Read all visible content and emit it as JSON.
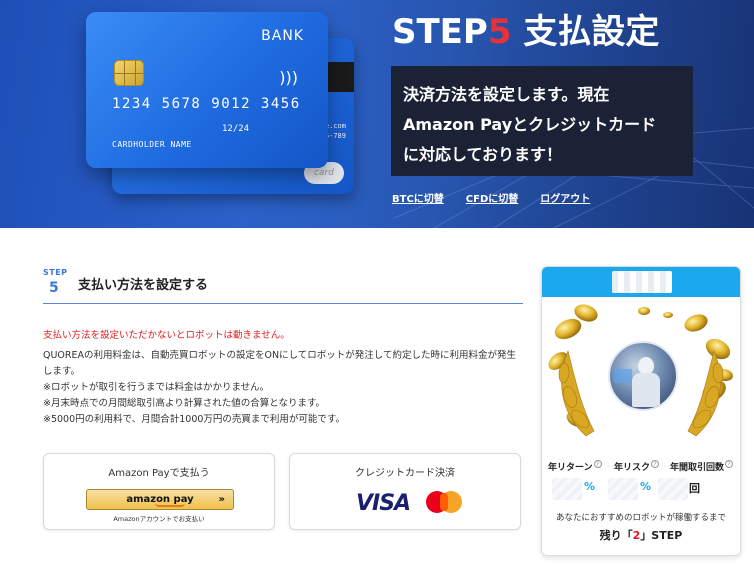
{
  "hero": {
    "card": {
      "bank": "BANK",
      "number": "1234 5678 9012 3456",
      "expiry": "12/24",
      "holder": "CARDHOLDER NAME",
      "back_text": "the.com\nna6-789",
      "back_logo": "card"
    },
    "title_prefix": "STEP",
    "title_number": "5",
    "title_suffix": " 支払設定",
    "description": "決済方法を設定します。現在\nAmazon Payとクレジットカード\nに対応しております！",
    "links": [
      "BTCに切替",
      "CFDに切替",
      "ログアウト"
    ]
  },
  "section": {
    "step_label": "STEP",
    "step_number": "5",
    "title": "支払い方法を設定する",
    "warning": "支払い方法を設定いただかないとロボットは動きません。",
    "notes": [
      "QUOREAの利用料金は、自動売買ロボットの設定をONにしてロボットが発注して約定した時に利用料金が発生します。",
      "※ロボットが取引を行うまでは料金はかかりません。",
      "※月末時点での月間総取引高より計算された値の合算となります。",
      "※5000円の利用料で、月間合計1000万円の売買まで利用が可能です。"
    ]
  },
  "payment": {
    "amazon": {
      "label": "Amazon Payで支払う",
      "button": "amazon pay",
      "button_arrow": "»",
      "sub": "Amazonアカウントでお支払い"
    },
    "credit": {
      "label": "クレジットカード決済",
      "visa": "VISA"
    }
  },
  "robot": {
    "stats": [
      {
        "label": "年リターン",
        "unit": "%"
      },
      {
        "label": "年リスク",
        "unit": "%"
      },
      {
        "label": "年間取引回数",
        "unit": "回"
      }
    ],
    "help_glyph": "?",
    "recommend": "あなたにおすすめのロボットが稼働するまで",
    "remain_prefix": "残り「",
    "remain_number": "2",
    "remain_suffix": "」STEP",
    "colors": {
      "header": "#19a9ec",
      "accent": "#e21b1b"
    }
  }
}
